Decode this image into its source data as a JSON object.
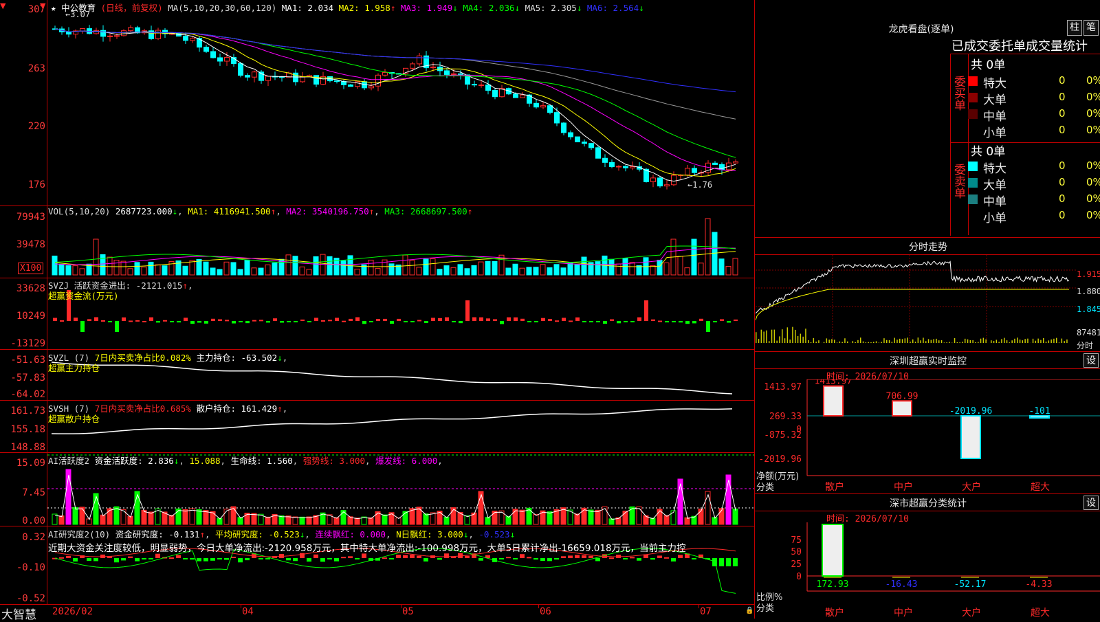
{
  "colors": {
    "up": "#ff2a2a",
    "down": "#00ffff",
    "ma1": "#ffffff",
    "ma2": "#ffff00",
    "ma3": "#ff00ff",
    "ma4": "#00ff00",
    "ma5": "#999999",
    "ma6": "#3030ff",
    "grid": "#c00000",
    "yellow": "#ffff3c",
    "cyan": "#00e5ff",
    "magenta": "#ff00ff",
    "green": "#00ff00",
    "red": "#ff2a2a"
  },
  "main": {
    "star": "★",
    "stock_name": "中公教育",
    "period": "(日线，前复权)",
    "ma_prefix": "MA(5,10,20,30,60,120)",
    "ma": [
      {
        "label": "MA1: 2.034",
        "arrow": ""
      },
      {
        "label": "MA2: 1.958",
        "arrow": "↑"
      },
      {
        "label": "MA3: 1.949",
        "arrow": "↓"
      },
      {
        "label": "MA4: 2.036",
        "arrow": "↓"
      },
      {
        "label": "MA5: 2.305",
        "arrow": "↓"
      },
      {
        "label": "MA6: 2.564",
        "arrow": "↓"
      }
    ],
    "high_label": "3.07",
    "low_label": "1.76",
    "yticks": [
      "307",
      "263",
      "220",
      "176"
    ]
  },
  "vol": {
    "header_a": "VOL(5,10,20)",
    "header_b": "2687723.000",
    "arrow_b": "↓",
    "ma1": "MA1: 4116941.500",
    "arrow_1": "↑",
    "ma2": "MA2: 3540196.750",
    "arrow_2": "↑",
    "ma3": "MA3: 2668697.500",
    "arrow_3": "↑",
    "yticks": [
      "79943",
      "39478"
    ],
    "unit": "X100"
  },
  "svzj": {
    "header_a": "SVZJ  活跃资金进出: -2121.015",
    "arrow": "↑",
    "comma": ",",
    "sub": "超赢资金流(万元)",
    "yticks": [
      "33628",
      "10249",
      "-13129"
    ]
  },
  "svzl": {
    "header_a": "SVZL (7)",
    "header_b": "7日内买卖净占比0.082%",
    "header_c": "主力持仓: -63.502",
    "arrow": "↓",
    "comma": ",",
    "sub": "超赢主力持仓",
    "yticks": [
      "-51.63",
      "-57.83",
      "-64.02"
    ]
  },
  "svsh": {
    "header_a": "SVSH (7)",
    "header_b": "7日内买卖净占比0.685%",
    "header_c": "散户持仓: 161.429",
    "arrow": "↑",
    "comma": ",",
    "sub": "超赢散户持仓",
    "yticks": [
      "161.73",
      "155.18",
      "148.88"
    ]
  },
  "ai": {
    "header_a": "AI活跃度2",
    "header_b": "资金活跃度: 2.836",
    "arrow_b": "↓",
    "header_c": "15.088",
    "header_d": "生命线: 1.560",
    "header_e": "强势线: 3.000",
    "header_f": "爆发线: 6.000",
    "comma": ",",
    "yticks": [
      "15.09",
      "7.45",
      "0.00"
    ]
  },
  "research": {
    "header_a": "AI研究度2(10)",
    "header_b": "资金研究度: -0.131",
    "arrow_b": "↑",
    "header_c": "平均研究度: -0.523",
    "arrow_c": "↓",
    "header_d": "连续飘红: 0.000",
    "header_e": "N日飘红: 3.000",
    "arrow_e": "↓",
    "header_f": "-0.523",
    "arrow_f": "↓",
    "comma": ",",
    "text": "近期大资金关注度较低，明显弱势，今日大单净流出:-2120.958万元，其中特大单净流出:-100.998万元，大单5日累计净出-16659.018万元，当前主力控",
    "yticks": [
      "0.32",
      "-0.10",
      "-0.52"
    ]
  },
  "xaxis": {
    "brand": "大智慧",
    "labels": [
      "2026/02",
      "04",
      "05",
      "06",
      "07"
    ]
  },
  "right": {
    "dragon_title": "龙虎看盘(逐单)",
    "btn1": "柱",
    "btn2": "笔",
    "table_title": "已成交委托单成交量统计",
    "buy_side": "委买单",
    "sell_side": "委卖单",
    "buy_total": "共 0单",
    "sell_total": "共 0单",
    "buy_rows": [
      {
        "name": "特大",
        "count": "0",
        "pct": "0%",
        "color": "#ff0000"
      },
      {
        "name": "大单",
        "count": "0",
        "pct": "0%",
        "color": "#8b0000"
      },
      {
        "name": "中单",
        "count": "0",
        "pct": "0%",
        "color": "#5a0000"
      },
      {
        "name": "小单",
        "count": "0",
        "pct": "0%",
        "color": "#000000"
      }
    ],
    "sell_rows": [
      {
        "name": "特大",
        "count": "0",
        "pct": "0%",
        "color": "#00ffff"
      },
      {
        "name": "大单",
        "count": "0",
        "pct": "0%",
        "color": "#008b8b"
      },
      {
        "name": "中单",
        "count": "0",
        "pct": "0%",
        "color": "#1b7f80"
      },
      {
        "name": "小单",
        "count": "0",
        "pct": "0%",
        "color": "#000000"
      }
    ],
    "intraday_title": "分时走势",
    "intraday_prices": [
      "1.915",
      "1.880",
      "1.845"
    ],
    "intraday_vol": "87481",
    "intraday_vol_label": "分时",
    "sz_title": "深圳超赢实时监控",
    "sz_set": "设",
    "sz_time": "时间: 2026/07/10",
    "sz_yticks": [
      "1413.97",
      "269.33",
      "0",
      "-875.32",
      "-2019.96"
    ],
    "sz_values": [
      "1413.97",
      "706.99",
      "-2019.96",
      "-101"
    ],
    "sz_axis_a": "净额(万元)",
    "sz_axis_b": "分类",
    "categories": [
      "散户",
      "中户",
      "大户",
      "超大"
    ],
    "cls_title": "深市超赢分类统计",
    "cls_set": "设",
    "cls_time": "时间: 2026/07/10",
    "cls_yticks": [
      "75",
      "50",
      "25",
      "0"
    ],
    "cls_values": [
      "172.93",
      "-16.43",
      "-52.17",
      "-4.33"
    ],
    "cls_axis_a": "比例%",
    "cls_axis_b": "分类"
  },
  "chart_data": {
    "type": "candlestick",
    "title": "中公教育",
    "high": 3.07,
    "low": 1.76,
    "ylim": [
      1.76,
      3.07
    ],
    "x_labels": [
      "2026/02",
      "04",
      "05",
      "06",
      "07"
    ]
  }
}
